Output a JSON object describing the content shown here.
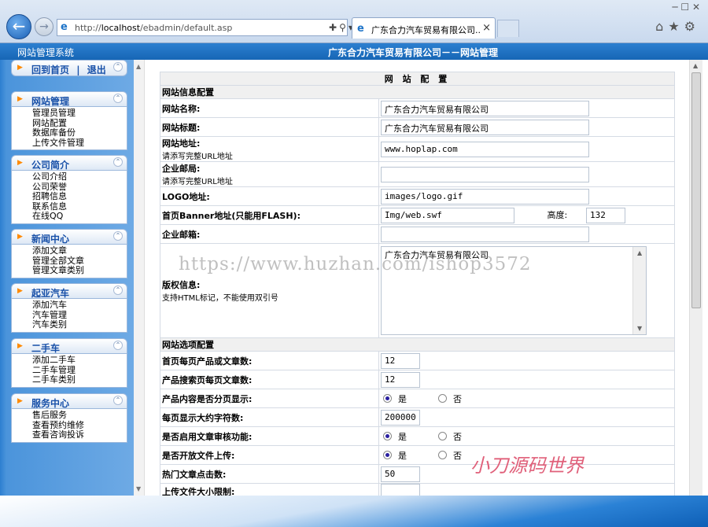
{
  "browser": {
    "url_prefix": "http://",
    "url_host": "localhost",
    "url_path": "/ebadmin/default.asp",
    "tab_title": "广东合力汽车贸易有限公司...",
    "tab_close": "×"
  },
  "header": {
    "system_name": "网站管理系统",
    "title": "广东合力汽车贸易有限公司－－网站管理"
  },
  "sidebar": {
    "top_links": {
      "home": "回到首页",
      "separator": "|",
      "logout": "退出"
    },
    "panels": [
      {
        "title": "网站管理",
        "items": [
          "管理员管理",
          "网站配置",
          "数据库备份",
          "上传文件管理"
        ]
      },
      {
        "title": "公司简介",
        "items": [
          "公司介绍",
          "公司荣誉",
          "招聘信息",
          "联系信息",
          "在线QQ"
        ]
      },
      {
        "title": "新闻中心",
        "items": [
          "添加文章",
          "管理全部文章",
          "管理文章类别"
        ]
      },
      {
        "title": "起亚汽车",
        "items": [
          "添加汽车",
          "汽车管理",
          "汽车类别"
        ]
      },
      {
        "title": "二手车",
        "items": [
          "添加二手车",
          "二手车管理",
          "二手车类别"
        ]
      },
      {
        "title": "服务中心",
        "items": [
          "售后服务",
          "查看预约维修",
          "查看咨询投诉"
        ]
      }
    ]
  },
  "form": {
    "heading": "网 站 配 置",
    "section_info": "网站信息配置",
    "site_name_label": "网站名称:",
    "site_name_value": "广东合力汽车贸易有限公司",
    "site_title_label": "网站标题:",
    "site_title_value": "广东合力汽车贸易有限公司",
    "site_url_label": "网站地址:",
    "site_url_hint": "请添写完整URL地址",
    "site_url_value": "www.hoplap.com",
    "email_label": "企业邮局:",
    "email_hint": "请添写完整URL地址",
    "email_value": "",
    "logo_label": "LOGO地址:",
    "logo_value": "images/logo.gif",
    "banner_label": "首页Banner地址(只能用FLASH):",
    "banner_value": "Img/web.swf",
    "height_label": "高度:",
    "height_value": "132",
    "mailbox_label": "企业邮箱:",
    "mailbox_value": "",
    "copyright_label": "版权信息:",
    "copyright_hint": "支持HTML标记，不能使用双引号",
    "copyright_value": "广东合力汽车贸易有限公司",
    "section_options": "网站选项配置",
    "per_page_label": "首页每页产品或文章数:",
    "per_page_value": "12",
    "search_per_page_label": "产品搜索页每页文章数:",
    "search_per_page_value": "12",
    "paginate_label": "产品内容是否分页显示:",
    "chars_label": "每页显示大约字符数:",
    "chars_value": "200000",
    "audit_label": "是否启用文章审核功能:",
    "upload_label": "是否开放文件上传:",
    "hot_label": "热门文章点击数:",
    "hot_value": "50",
    "upload_size_label": "上传文件大小限制:",
    "yes": "是",
    "no": "否"
  },
  "watermarks": {
    "url": "https://www.huzhan.com/ishop3572",
    "brand": "小刀源码世界"
  }
}
